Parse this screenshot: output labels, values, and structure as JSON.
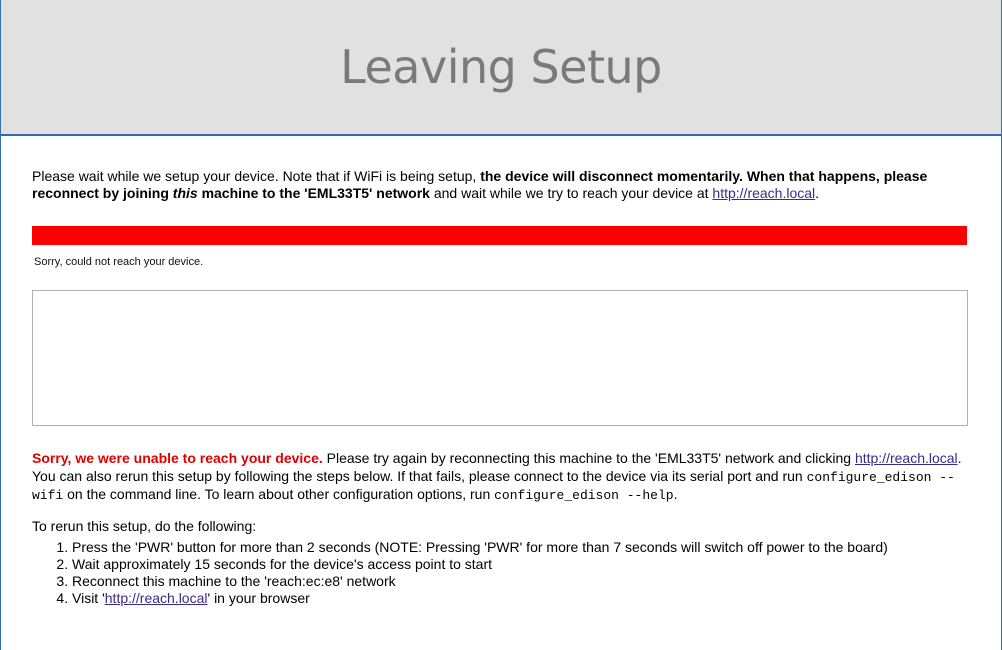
{
  "header": {
    "title": "Leaving Setup"
  },
  "intro": {
    "text1": "Please wait while we setup your device. Note that if WiFi is being setup, ",
    "bold1": "the device will disconnect momentarily. When that happens, please reconnect by joining ",
    "bold_italic": "this",
    "bold2": " machine to the 'EML33T5' network",
    "text2": " and wait while we try to reach your device at ",
    "link": "http://reach.local",
    "text3": "."
  },
  "progress": {
    "percent": 100,
    "color": "#ff0000",
    "status": "Sorry, could not reach your device."
  },
  "log": {
    "value": ""
  },
  "error": {
    "strong": "Sorry, we were unable to reach your device.",
    "text1": " Please try again by reconnecting this machine to the 'EML33T5' network and clicking ",
    "link": "http://reach.local",
    "text2": ". You can also rerun this setup by following the steps below. If that fails, please connect to the device via its serial port and run ",
    "code1": "configure_edison --wifi",
    "text3": " on the command line. To learn about other configuration options, run ",
    "code2": "configure_edison --help",
    "text4": "."
  },
  "rerun": {
    "title": "To rerun this setup, do the following:",
    "steps": [
      "Press the 'PWR' button for more than 2 seconds (NOTE: Pressing 'PWR' for more than 7 seconds will switch off power to the board)",
      "Wait approximately 15 seconds for the device's access point to start",
      "Reconnect this machine to the 'reach:ec:e8' network"
    ],
    "step4_pre": "Visit '",
    "step4_link": "http://reach.local",
    "step4_post": "' in your browser"
  },
  "colors": {
    "header_bg": "#e1e1e1",
    "header_text": "#7a7a7a",
    "error": "#e00000",
    "link": "#3a2a8a",
    "progress": "#ff0000"
  }
}
